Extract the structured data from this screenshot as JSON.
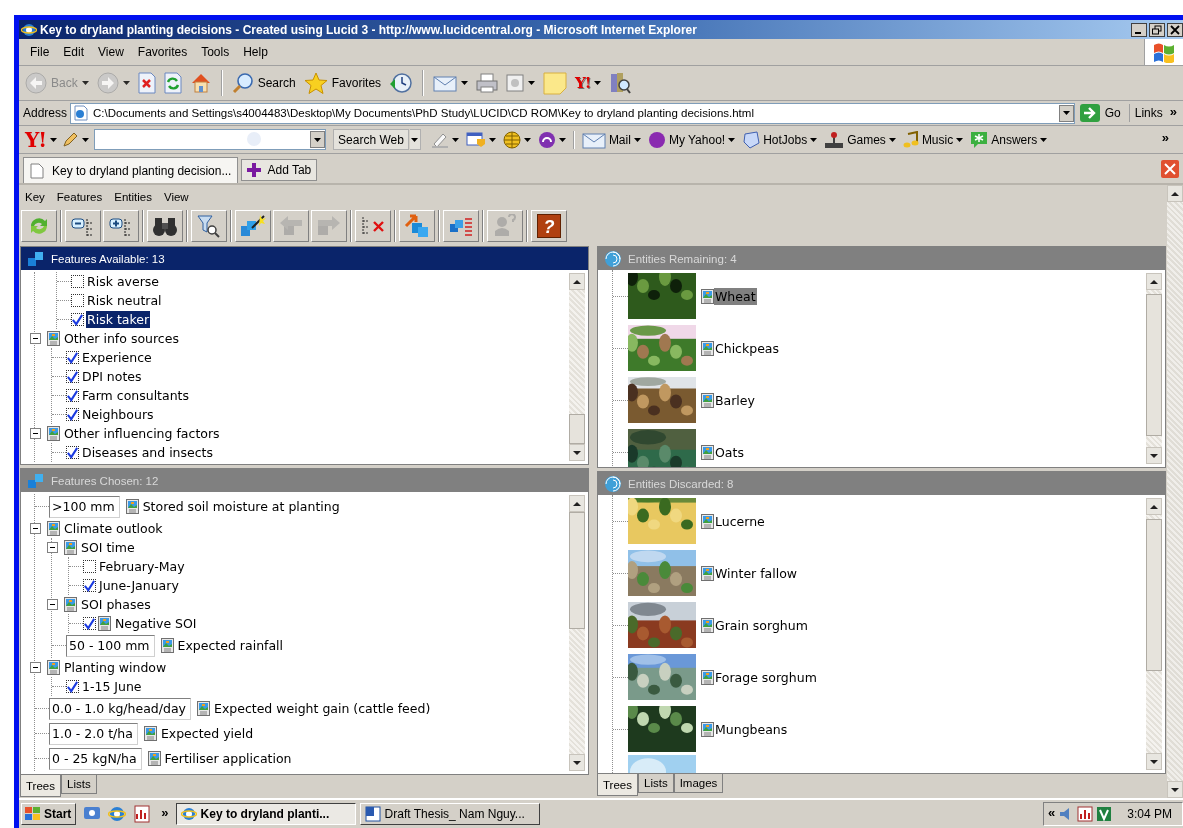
{
  "window": {
    "title": "Key to dryland planting decisions - Created using Lucid 3 - http://www.lucidcentral.org - Microsoft Internet Explorer"
  },
  "menu": [
    "File",
    "Edit",
    "View",
    "Favorites",
    "Tools",
    "Help"
  ],
  "toolbar": [
    {
      "items": [
        {
          "kind": "back",
          "label": "Back",
          "disabled": true,
          "menu": true
        },
        {
          "kind": "forward",
          "disabled": true,
          "menu": true
        },
        {
          "kind": "stop",
          "disabled": false,
          "menu": false
        },
        {
          "kind": "refresh",
          "disabled": false,
          "menu": false
        },
        {
          "kind": "home",
          "disabled": false,
          "menu": false
        }
      ]
    },
    {
      "items": [
        {
          "kind": "search",
          "label": "Search",
          "disabled": false,
          "menu": false
        },
        {
          "kind": "favorites",
          "label": "Favorites",
          "disabled": false,
          "menu": false
        },
        {
          "kind": "history",
          "disabled": false,
          "menu": false
        }
      ]
    },
    {
      "items": [
        {
          "kind": "mail",
          "disabled": false,
          "menu": true
        },
        {
          "kind": "print",
          "disabled": false,
          "menu": false
        },
        {
          "kind": "edit",
          "disabled": false,
          "menu": true
        },
        {
          "kind": "note",
          "disabled": false,
          "menu": false
        },
        {
          "kind": "yahoo",
          "label": "Y!",
          "disabled": false,
          "menu": true
        },
        {
          "kind": "research",
          "disabled": false,
          "menu": false
        }
      ]
    }
  ],
  "address": {
    "label": "Address",
    "value": "C:\\Documents and Settings\\s4004483\\Desktop\\My Documents\\PhD Study\\LUCID\\CD ROM\\Key to dryland planting decisions.html",
    "go": "Go",
    "links": "Links",
    "more": "»"
  },
  "yahoo_bar": {
    "logo": "Y!",
    "search_button": "Search Web",
    "tools": [
      {
        "kind": "highlight"
      },
      {
        "kind": "popup-blocker"
      },
      {
        "kind": "globe"
      },
      {
        "kind": "audio"
      }
    ],
    "links": [
      {
        "kind": "mail",
        "label": "Mail"
      },
      {
        "kind": "my-yahoo",
        "label": "My Yahoo!"
      },
      {
        "kind": "hotjobs",
        "label": "HotJobs"
      },
      {
        "kind": "games",
        "label": "Games"
      },
      {
        "kind": "music",
        "label": "Music"
      },
      {
        "kind": "answers",
        "label": "Answers"
      }
    ],
    "more": "»"
  },
  "browser_tabs": {
    "tabs": [
      {
        "label": "Key to dryland planting decision...",
        "selected": true
      }
    ],
    "add_tab": "Add Tab"
  },
  "app": {
    "menu": [
      "Key",
      "Features",
      "Entities",
      "View"
    ],
    "toolbar": [
      {
        "items": [
          {
            "kind": "restart",
            "disabled": false
          }
        ]
      },
      {
        "items": [
          {
            "kind": "collapse",
            "disabled": false
          },
          {
            "kind": "expand",
            "disabled": false
          }
        ]
      },
      {
        "items": [
          {
            "kind": "find",
            "disabled": false
          }
        ]
      },
      {
        "items": [
          {
            "kind": "filter",
            "disabled": false
          }
        ]
      },
      {
        "items": [
          {
            "kind": "best",
            "disabled": false
          },
          {
            "kind": "previous",
            "disabled": true
          },
          {
            "kind": "next",
            "disabled": true
          }
        ]
      },
      {
        "items": [
          {
            "kind": "clear",
            "disabled": false
          }
        ]
      },
      {
        "items": [
          {
            "kind": "move",
            "disabled": false
          }
        ]
      },
      {
        "items": [
          {
            "kind": "differences",
            "disabled": false
          }
        ]
      },
      {
        "items": [
          {
            "kind": "query",
            "disabled": true
          }
        ]
      },
      {
        "items": [
          {
            "kind": "help",
            "glyph": "?",
            "disabled": false
          }
        ]
      }
    ]
  },
  "features_available": {
    "title": "Features Available: 13",
    "active": true,
    "tree": [
      {
        "kind": "group",
        "children": [
          {
            "kind": "state",
            "label": "Risk averse",
            "checked": false,
            "selected": false
          },
          {
            "kind": "state",
            "label": "Risk neutral",
            "checked": false,
            "selected": false
          },
          {
            "kind": "state",
            "label": "Risk taker",
            "checked": true,
            "selected": true
          }
        ]
      },
      {
        "kind": "group",
        "label": "Other info sources",
        "expanded": true,
        "children": [
          {
            "kind": "state",
            "label": "Experience",
            "checked": true,
            "selected": false
          },
          {
            "kind": "state",
            "label": "DPI notes",
            "checked": true,
            "selected": false
          },
          {
            "kind": "state",
            "label": "Farm consultants",
            "checked": true,
            "selected": false
          },
          {
            "kind": "state",
            "label": "Neighbours",
            "checked": true,
            "selected": false
          }
        ]
      },
      {
        "kind": "group",
        "label": "Other influencing factors",
        "expanded": true,
        "children": [
          {
            "kind": "state",
            "label": "Diseases and insects",
            "checked": true,
            "selected": false
          }
        ]
      }
    ]
  },
  "features_chosen": {
    "title": "Features Chosen: 12",
    "active": false,
    "tree": [
      {
        "kind": "numeric",
        "value": ">100 mm",
        "label": "Stored soil moisture at planting",
        "selected": false
      },
      {
        "kind": "group",
        "label": "Climate outlook",
        "expanded": true,
        "children": [
          {
            "kind": "group",
            "label": "SOI time",
            "expanded": true,
            "children": [
              {
                "kind": "state",
                "label": "February-May",
                "checked": false,
                "selected": false
              },
              {
                "kind": "state",
                "label": "June-January",
                "checked": true,
                "selected": false
              }
            ]
          },
          {
            "kind": "group",
            "label": "SOI phases",
            "expanded": true,
            "children": [
              {
                "kind": "state-image",
                "label": "Negative SOI",
                "checked": true,
                "selected": false
              }
            ]
          },
          {
            "kind": "numeric",
            "value": "50 - 100 mm",
            "label": "Expected rainfall",
            "selected": false
          }
        ]
      },
      {
        "kind": "group",
        "label": "Planting window",
        "expanded": true,
        "children": [
          {
            "kind": "state",
            "label": "1-15 June",
            "checked": true,
            "selected": false
          }
        ]
      },
      {
        "kind": "numeric",
        "value": "0.0 - 1.0 kg/head/day",
        "label": "Expected weight gain (cattle feed)",
        "selected": false
      },
      {
        "kind": "numeric",
        "value": "1.0 - 2.0 t/ha",
        "label": "Expected yield",
        "selected": false
      },
      {
        "kind": "numeric",
        "value": "0 - 25 kgN/ha",
        "label": "Fertiliser application",
        "selected": false
      }
    ],
    "tabs": [
      {
        "label": "Trees",
        "selected": true
      },
      {
        "label": "Lists",
        "selected": false
      }
    ]
  },
  "entities_remaining": {
    "title": "Entities Remaining: 4",
    "active": false,
    "items": [
      {
        "kind": "entity",
        "label": "Wheat",
        "selected": true
      },
      {
        "kind": "entity",
        "label": "Chickpeas",
        "selected": false
      },
      {
        "kind": "entity",
        "label": "Barley",
        "selected": false
      },
      {
        "kind": "entity",
        "label": "Oats",
        "selected": false
      }
    ]
  },
  "entities_discarded": {
    "title": "Entities Discarded: 8",
    "active": false,
    "items": [
      {
        "kind": "entity",
        "label": "Lucerne",
        "selected": false
      },
      {
        "kind": "entity",
        "label": "Winter fallow",
        "selected": false
      },
      {
        "kind": "entity",
        "label": "Grain sorghum",
        "selected": false
      },
      {
        "kind": "entity",
        "label": "Forage sorghum",
        "selected": false
      },
      {
        "kind": "entity",
        "label": "Mungbeans",
        "selected": false
      },
      {
        "kind": "picture"
      }
    ],
    "tabs": [
      {
        "label": "Trees",
        "selected": true
      },
      {
        "label": "Lists",
        "selected": false
      },
      {
        "label": "Images",
        "selected": false
      }
    ]
  },
  "taskbar": {
    "start": "Start",
    "more": "»",
    "tasks": [
      {
        "label": "Key to dryland planti...",
        "selected": true
      },
      {
        "label": "Draft Thesis_ Nam Nguy...",
        "selected": false
      }
    ],
    "tray_more": "«",
    "time": "3:04 PM"
  }
}
